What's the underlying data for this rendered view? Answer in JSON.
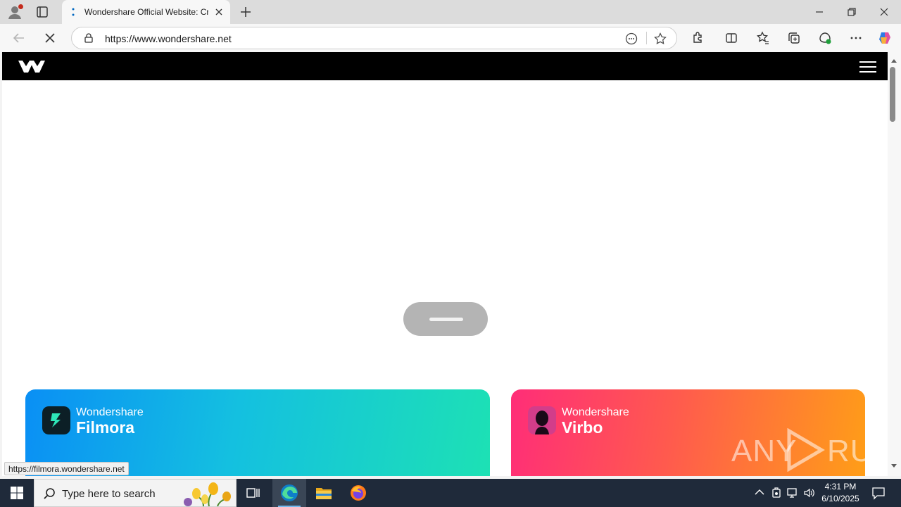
{
  "browser": {
    "tab_title": "Wondershare Official Website: Cre",
    "url": "https://www.wondershare.net"
  },
  "page": {
    "cards": [
      {
        "brand": "Wondershare",
        "product": "Filmora"
      },
      {
        "brand": "Wondershare",
        "product": "Virbo"
      }
    ],
    "status_url": "https://filmora.wondershare.net",
    "watermark": {
      "left": "ANY",
      "right": "RUN"
    }
  },
  "taskbar": {
    "search_placeholder": "Type here to search",
    "time": "4:31 PM",
    "date": "6/10/2025"
  },
  "colors": {
    "filmora_gradient": [
      "#0a8ff5",
      "#1de1b4"
    ],
    "virbo_gradient": [
      "#ff2d78",
      "#ff9e17"
    ],
    "site_header": "#000000",
    "taskbar": "#1f2a3a"
  },
  "icons": [
    "profile-icon",
    "tab-actions-icon",
    "loading-spinner-icon",
    "close-icon",
    "plus-icon",
    "minimize-icon",
    "restore-icon",
    "back-icon",
    "stop-loading-icon",
    "site-info-icon",
    "immersive-reader-icon",
    "star-icon",
    "extensions-icon",
    "split-screen-icon",
    "favorites-icon",
    "collections-icon",
    "browser-essentials-icon",
    "more-icon",
    "copilot-icon",
    "wondershare-logo",
    "menu-icon",
    "windows-start-icon",
    "search-icon",
    "task-view-icon",
    "edge-icon",
    "file-explorer-icon",
    "firefox-icon"
  ]
}
